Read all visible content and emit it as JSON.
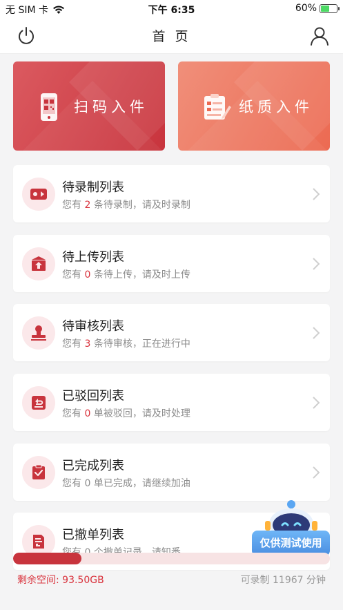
{
  "status_bar": {
    "carrier": "无 SIM 卡",
    "time": "下午 6:35",
    "battery_percent": "60%",
    "battery_level": 0.6
  },
  "nav": {
    "title": "首 页",
    "left_icon": "power-icon",
    "right_icon": "user-icon"
  },
  "entries": [
    {
      "label": "扫码入件",
      "icon": "qrcode-phone-icon"
    },
    {
      "label": "纸质入件",
      "icon": "paper-form-icon"
    }
  ],
  "lists": [
    {
      "title": "待录制列表",
      "prefix": "您有",
      "count": "2",
      "suffix": "条待录制，请及时录制",
      "icon": "video-camera-icon",
      "highlight": true
    },
    {
      "title": "待上传列表",
      "prefix": "您有",
      "count": "0",
      "suffix": "条待上传，请及时上传",
      "icon": "upload-box-icon",
      "highlight": true
    },
    {
      "title": "待审核列表",
      "prefix": "您有",
      "count": "3",
      "suffix": "条待审核，正在进行中",
      "icon": "stamp-icon",
      "highlight": true
    },
    {
      "title": "已驳回列表",
      "prefix": "您有",
      "count": "0",
      "suffix": "单被驳回，请及时处理",
      "icon": "return-icon",
      "highlight": true
    },
    {
      "title": "已完成列表",
      "prefix": "您有",
      "count": "0",
      "suffix": "单已完成，请继续加油",
      "icon": "check-clipboard-icon",
      "highlight": false
    },
    {
      "title": "已撤单列表",
      "prefix": "您有",
      "count": "0",
      "suffix": "个撤单记录，请知悉",
      "icon": "withdraw-doc-icon",
      "highlight": false
    }
  ],
  "test_badge": "仅供测试使用",
  "storage": {
    "remaining": "剩余空间: 93.50GB",
    "recordable": "可录制 11967 分钟",
    "used_fraction": 0.215
  },
  "colors": {
    "accent": "#c8343d",
    "accent_light": "#fbe8ea",
    "paper_card": "#ec6a52",
    "badge_blue": "#4a8de0"
  }
}
